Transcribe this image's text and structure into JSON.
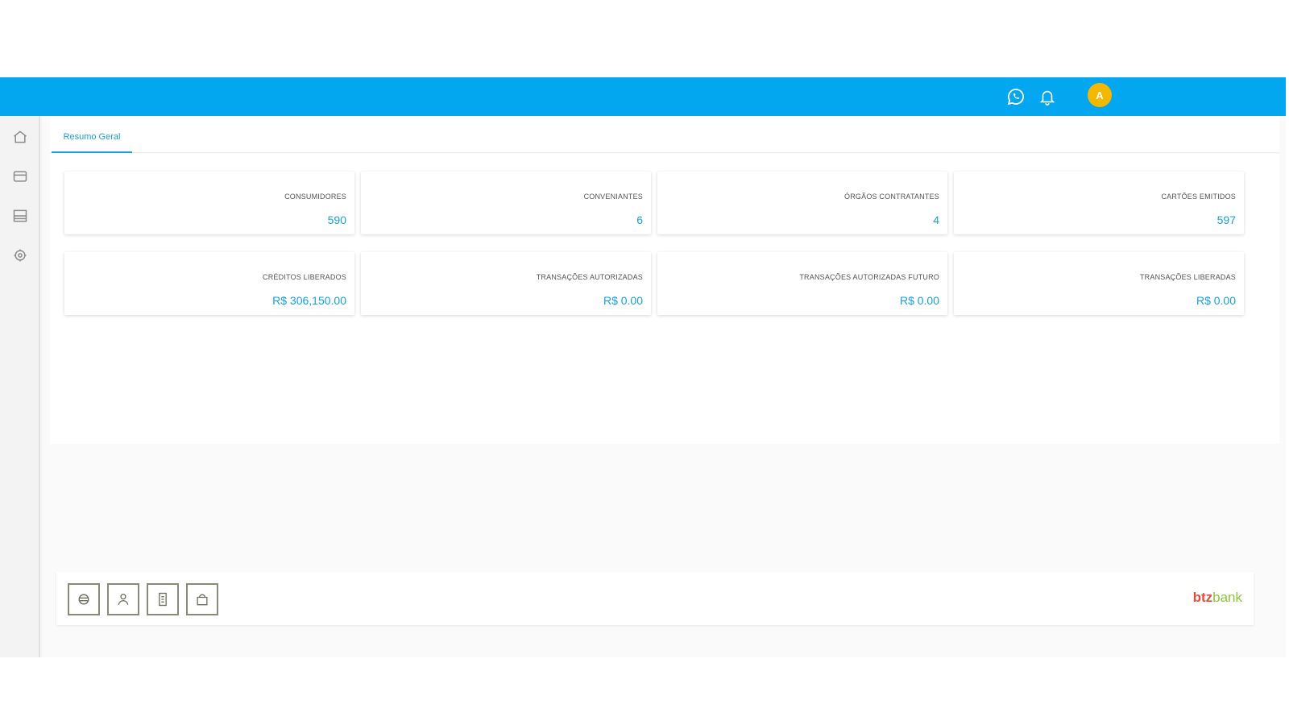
{
  "topbar": {
    "avatar_initial": "A",
    "icons": [
      "whatsapp-icon",
      "bell-icon"
    ],
    "color": "#02a7f0"
  },
  "sidebar": {
    "items": [
      "home-icon",
      "card-icon",
      "list-icon",
      "settings-icon"
    ]
  },
  "tabs": [
    {
      "label": "Resumo Geral",
      "active": true
    }
  ],
  "cards": [
    {
      "label": "Consumidores",
      "value": "590"
    },
    {
      "label": "Conveniantes",
      "value": "6"
    },
    {
      "label": "Órgãos Contratantes",
      "value": "4"
    },
    {
      "label": "Cartões Emitidos",
      "value": "597"
    },
    {
      "label": "Créditos Liberados",
      "value": "R$ 306,150.00"
    },
    {
      "label": "Transações Autorizadas",
      "value": "R$ 0.00"
    },
    {
      "label": "Transações Autorizadas Futuro",
      "value": "R$ 0.00"
    },
    {
      "label": "Transações Liberadas",
      "value": "R$ 0.00"
    }
  ],
  "footer": {
    "buttons": [
      "card-reader-icon",
      "user-icon",
      "document-icon",
      "bag-icon"
    ],
    "brand_part1": "btz",
    "brand_part2": "bank"
  },
  "colors": {
    "accent": "#1a9de2",
    "avatar": "#f5b800"
  }
}
